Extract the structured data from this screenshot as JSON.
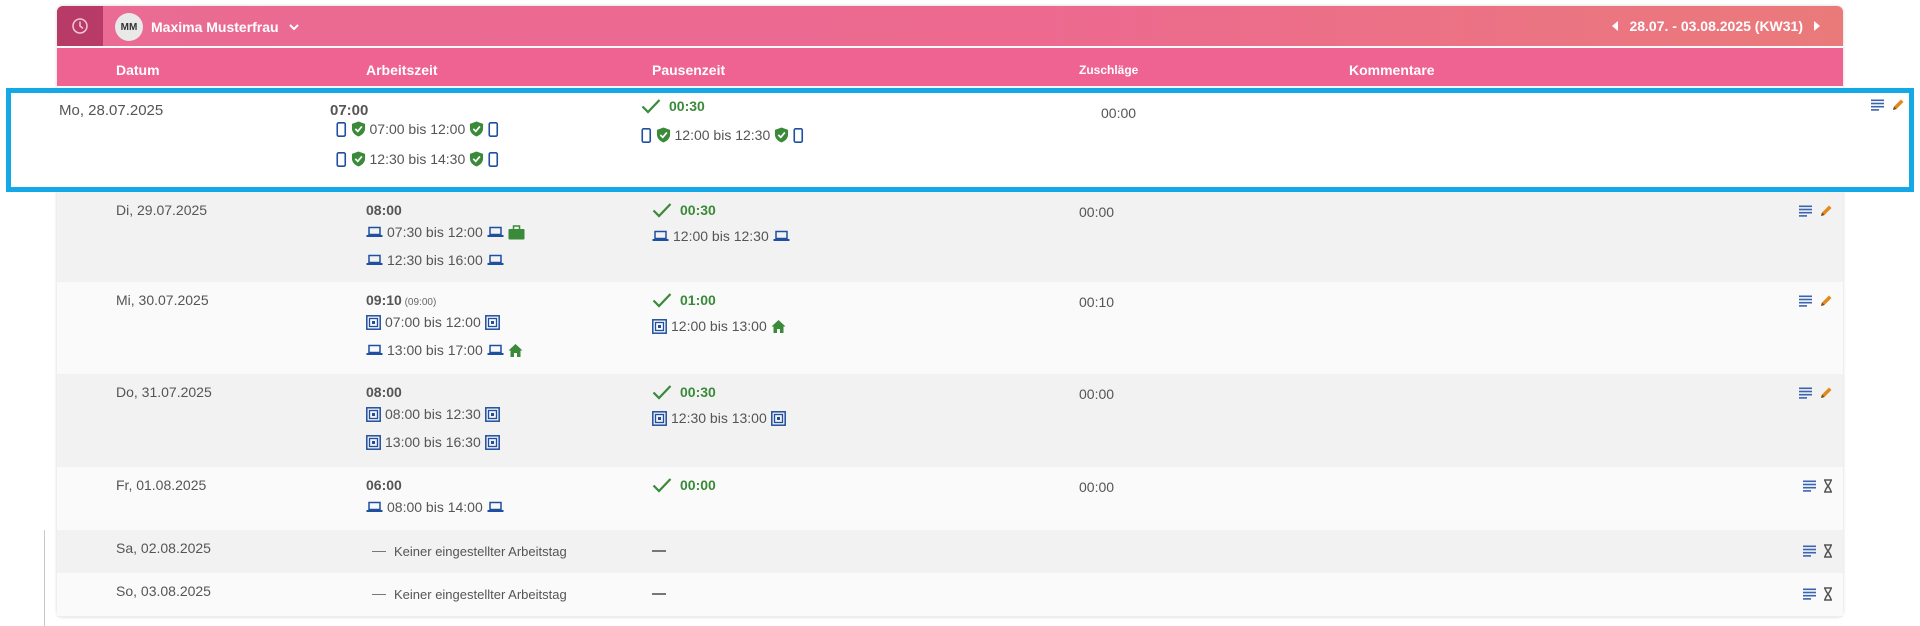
{
  "topbar": {
    "user_initials": "MM",
    "user_name": "Maxima Musterfrau",
    "week_range": "28.07. - 03.08.2025 (KW31)"
  },
  "columns": {
    "datum": "Datum",
    "arbeitszeit": "Arbeitszeit",
    "pausenzeit": "Pausenzeit",
    "zuschlaege": "Zuschläge",
    "kommentare": "Kommentare"
  },
  "colors": {
    "accent_pink": "#ee6391",
    "header_dark": "#b83a67",
    "selection_border": "#14a9e6",
    "approved_green": "#3a8a3a",
    "device_blue": "#1f4fa0",
    "edit_orange": "#e08a1e"
  },
  "days": [
    {
      "date": "Mo, 28.07.2025",
      "total": "07:00",
      "entries": [
        {
          "text": "07:00 bis 12:00",
          "icons": [
            "phone-icon",
            "check-shield-icon",
            "check-shield-icon",
            "phone-icon"
          ]
        },
        {
          "text": "12:30 bis 14:30",
          "icons": [
            "phone-icon",
            "check-shield-icon",
            "check-shield-icon",
            "phone-icon"
          ]
        }
      ],
      "pause_total": "00:30",
      "pause_entries": [
        {
          "text": "12:00 bis 12:30",
          "icons": [
            "phone-icon",
            "check-shield-icon",
            "check-shield-icon",
            "phone-icon"
          ]
        }
      ],
      "zuschlaege": "00:00",
      "actions": [
        "notes-icon",
        "edit-pencil-icon"
      ]
    },
    {
      "date": "Di, 29.07.2025",
      "total": "08:00",
      "entries": [
        {
          "text": "07:30 bis 12:00",
          "icons": [
            "laptop-icon",
            "laptop-icon",
            "briefcase-icon"
          ]
        },
        {
          "text": "12:30 bis 16:00",
          "icons": [
            "laptop-icon",
            "laptop-icon"
          ]
        }
      ],
      "pause_total": "00:30",
      "pause_entries": [
        {
          "text": "12:00 bis 12:30",
          "icons": [
            "laptop-icon",
            "laptop-icon"
          ]
        }
      ],
      "zuschlaege": "00:00",
      "actions": [
        "notes-icon",
        "edit-pencil-icon"
      ]
    },
    {
      "date": "Mi, 30.07.2025",
      "total": "09:10",
      "total_hint": "(09:00)",
      "entries": [
        {
          "text": "07:00 bis 12:00",
          "icons": [
            "terminal-icon",
            "terminal-icon"
          ]
        },
        {
          "text": "13:00 bis 17:00",
          "icons": [
            "laptop-icon",
            "laptop-icon",
            "home-icon"
          ]
        }
      ],
      "pause_total": "01:00",
      "pause_entries": [
        {
          "text": "12:00 bis 13:00",
          "icons": [
            "terminal-icon",
            "home-icon"
          ]
        }
      ],
      "zuschlaege": "00:10",
      "actions": [
        "notes-icon",
        "edit-pencil-icon"
      ]
    },
    {
      "date": "Do, 31.07.2025",
      "total": "08:00",
      "entries": [
        {
          "text": "08:00 bis 12:30",
          "icons": [
            "terminal-icon",
            "terminal-icon"
          ]
        },
        {
          "text": "13:00 bis 16:30",
          "icons": [
            "terminal-icon",
            "terminal-icon"
          ]
        }
      ],
      "pause_total": "00:30",
      "pause_entries": [
        {
          "text": "12:30 bis 13:00",
          "icons": [
            "terminal-icon",
            "terminal-icon"
          ]
        }
      ],
      "zuschlaege": "00:00",
      "actions": [
        "notes-icon",
        "edit-pencil-icon"
      ]
    },
    {
      "date": "Fr, 01.08.2025",
      "total": "06:00",
      "entries": [
        {
          "text": "08:00 bis 14:00",
          "icons": [
            "laptop-icon",
            "laptop-icon"
          ]
        }
      ],
      "pause_total": "00:00",
      "pause_entries": [],
      "zuschlaege": "00:00",
      "actions": [
        "notes-icon",
        "hourglass-icon"
      ]
    },
    {
      "date": "Sa, 02.08.2025",
      "no_workday": "Keiner eingestellter Arbeitstag",
      "actions": [
        "notes-icon",
        "hourglass-icon"
      ]
    },
    {
      "date": "So, 03.08.2025",
      "no_workday": "Keiner eingestellter Arbeitstag",
      "actions": [
        "notes-icon",
        "hourglass-icon"
      ]
    }
  ]
}
